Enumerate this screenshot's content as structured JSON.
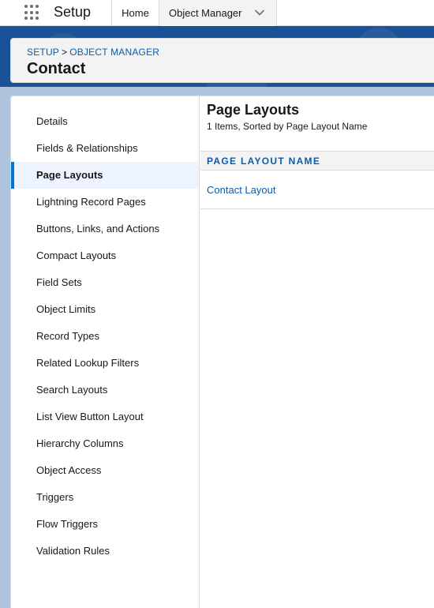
{
  "header": {
    "app_icon": "app-launcher-icon",
    "app_name": "Setup",
    "tabs": [
      {
        "label": "Home"
      },
      {
        "label": "Object Manager",
        "icon": "chevron-down-icon"
      }
    ]
  },
  "breadcrumb": {
    "setup": "SETUP",
    "separator": ">",
    "object_manager": "OBJECT MANAGER"
  },
  "object": {
    "title": "Contact"
  },
  "sidebar": {
    "items": [
      {
        "label": "Details"
      },
      {
        "label": "Fields & Relationships"
      },
      {
        "label": "Page Layouts",
        "active": true
      },
      {
        "label": "Lightning Record Pages"
      },
      {
        "label": "Buttons, Links, and Actions"
      },
      {
        "label": "Compact Layouts"
      },
      {
        "label": "Field Sets"
      },
      {
        "label": "Object Limits"
      },
      {
        "label": "Record Types"
      },
      {
        "label": "Related Lookup Filters"
      },
      {
        "label": "Search Layouts"
      },
      {
        "label": "List View Button Layout"
      },
      {
        "label": "Hierarchy Columns"
      },
      {
        "label": "Object Access"
      },
      {
        "label": "Triggers"
      },
      {
        "label": "Flow Triggers"
      },
      {
        "label": "Validation Rules"
      }
    ]
  },
  "content": {
    "title": "Page Layouts",
    "subtitle": "1 Items, Sorted by Page Layout Name",
    "columns": [
      "PAGE LAYOUT NAME"
    ],
    "rows": [
      {
        "name": "Contact Layout"
      }
    ]
  },
  "colors": {
    "brand_blue": "#1b5297",
    "link": "#0b5cab",
    "active_indicator": "#0176d3"
  }
}
